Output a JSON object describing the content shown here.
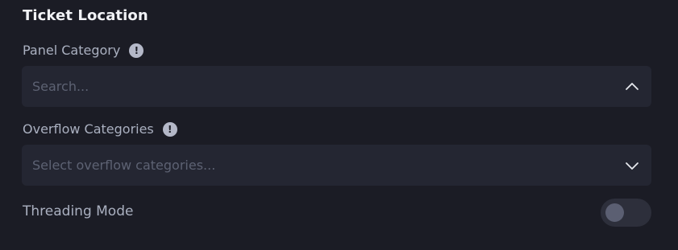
{
  "section": {
    "title": "Ticket Location"
  },
  "panel_category": {
    "label": "Panel Category",
    "info_glyph": "!",
    "placeholder": "Search...",
    "value": "",
    "state": "expanded",
    "chevron_icon": "chevron-up-icon"
  },
  "overflow_categories": {
    "label": "Overflow Categories",
    "info_glyph": "!",
    "placeholder": "Select overflow categories...",
    "value": "",
    "state": "collapsed",
    "chevron_icon": "chevron-down-icon"
  },
  "threading_mode": {
    "label": "Threading Mode",
    "enabled": false
  },
  "colors": {
    "background": "#1b1c25",
    "field_background": "#242632",
    "title_text": "#f1f2f6",
    "label_text": "#aab0c0",
    "placeholder_text": "#5d6273",
    "toggle_track": "#2d2f3b",
    "toggle_knob": "#5b5f72"
  }
}
